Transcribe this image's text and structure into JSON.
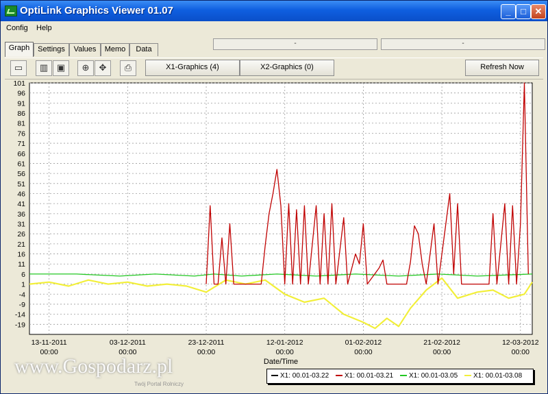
{
  "window": {
    "title": "OptiLink Graphics Viewer 01.07",
    "min_glyph": "_",
    "max_glyph": "□",
    "close_glyph": "✕"
  },
  "menu": [
    "Config",
    "Help"
  ],
  "tabs": [
    "Graph",
    "Settings",
    "Values",
    "Memo",
    "Data"
  ],
  "status_boxes": [
    "-",
    "-"
  ],
  "toolbar": {
    "x1_label": "X1-Graphics (4)",
    "x2_label": "X2-Graphics (0)",
    "refresh_label": "Refresh Now"
  },
  "icons": [
    "chart-view-icon",
    "columns-icon",
    "window-icon",
    "zoom-icon",
    "move-icon",
    "print-icon"
  ],
  "watermark": {
    "text": "www.Gospodarz.pl",
    "sub": "Twój Portal Rolniczy"
  },
  "colors": {
    "red_series": "#c00000",
    "green_series": "#22c722",
    "yellow_series": "#f2ef3a",
    "black_series": "#000000",
    "title_bar": "#0f5fe0"
  },
  "chart_data": {
    "type": "line",
    "xlabel": "Date/Time",
    "ylabel": "",
    "ylim": [
      -24,
      101
    ],
    "y_ticks": [
      101,
      96,
      91,
      86,
      81,
      76,
      71,
      66,
      61,
      56,
      51,
      46,
      41,
      36,
      31,
      26,
      21,
      16,
      11,
      6,
      1,
      -4,
      -9,
      -14,
      -19
    ],
    "x_range": [
      "2011-11-08",
      "2012-03-15"
    ],
    "x_ticks": [
      {
        "date": "2011-11-13",
        "label": "13-11-2011",
        "time": "00:00"
      },
      {
        "date": "2011-12-03",
        "label": "03-12-2011",
        "time": "00:00"
      },
      {
        "date": "2011-12-23",
        "label": "23-12-2011",
        "time": "00:00"
      },
      {
        "date": "2012-01-12",
        "label": "12-01-2012",
        "time": "00:00"
      },
      {
        "date": "2012-02-01",
        "label": "01-02-2012",
        "time": "00:00"
      },
      {
        "date": "2012-02-21",
        "label": "21-02-2012",
        "time": "00:00"
      },
      {
        "date": "2012-03-12",
        "label": "12-03-2012",
        "time": "00:00"
      }
    ],
    "grid": true,
    "legend_position": "bottom-right",
    "series": [
      {
        "name": "X1: 00.01-03.22",
        "color": "#000000",
        "points": []
      },
      {
        "name": "X1: 00.01-03.21",
        "color": "#c00000",
        "points": [
          [
            "2011-11-08",
            null
          ],
          [
            "2011-12-23",
            1
          ],
          [
            "2011-12-24",
            40
          ],
          [
            "2011-12-25",
            1
          ],
          [
            "2011-12-26",
            1
          ],
          [
            "2011-12-27",
            24
          ],
          [
            "2011-12-28",
            1
          ],
          [
            "2011-12-29",
            31
          ],
          [
            "2011-12-30",
            1
          ],
          [
            "2012-01-06",
            1
          ],
          [
            "2012-01-07",
            20
          ],
          [
            "2012-01-08",
            36
          ],
          [
            "2012-01-09",
            46
          ],
          [
            "2012-01-10",
            58
          ],
          [
            "2012-01-11",
            40
          ],
          [
            "2012-01-12",
            1
          ],
          [
            "2012-01-13",
            41
          ],
          [
            "2012-01-14",
            1
          ],
          [
            "2012-01-15",
            38
          ],
          [
            "2012-01-16",
            1
          ],
          [
            "2012-01-17",
            40
          ],
          [
            "2012-01-18",
            1
          ],
          [
            "2012-01-20",
            40
          ],
          [
            "2012-01-21",
            1
          ],
          [
            "2012-01-22",
            36
          ],
          [
            "2012-01-23",
            1
          ],
          [
            "2012-01-24",
            41
          ],
          [
            "2012-01-25",
            1
          ],
          [
            "2012-01-27",
            34
          ],
          [
            "2012-01-28",
            1
          ],
          [
            "2012-01-30",
            16
          ],
          [
            "2012-01-31",
            11
          ],
          [
            "2012-02-01",
            31
          ],
          [
            "2012-02-02",
            1
          ],
          [
            "2012-02-05",
            9
          ],
          [
            "2012-02-06",
            13
          ],
          [
            "2012-02-07",
            1
          ],
          [
            "2012-02-12",
            1
          ],
          [
            "2012-02-13",
            12
          ],
          [
            "2012-02-14",
            30
          ],
          [
            "2012-02-15",
            26
          ],
          [
            "2012-02-16",
            11
          ],
          [
            "2012-02-17",
            1
          ],
          [
            "2012-02-19",
            31
          ],
          [
            "2012-02-20",
            1
          ],
          [
            "2012-02-23",
            46
          ],
          [
            "2012-02-24",
            6
          ],
          [
            "2012-02-25",
            41
          ],
          [
            "2012-02-26",
            1
          ],
          [
            "2012-03-04",
            1
          ],
          [
            "2012-03-05",
            36
          ],
          [
            "2012-03-06",
            1
          ],
          [
            "2012-03-08",
            41
          ],
          [
            "2012-03-09",
            1
          ],
          [
            "2012-03-10",
            40
          ],
          [
            "2012-03-11",
            1
          ],
          [
            "2012-03-12",
            31
          ],
          [
            "2012-03-13",
            101
          ],
          [
            "2012-03-14",
            6
          ]
        ]
      },
      {
        "name": "X1: 00.01-03.05",
        "color": "#22c722",
        "points": [
          [
            "2011-11-08",
            6
          ],
          [
            "2011-11-20",
            6
          ],
          [
            "2011-12-01",
            5
          ],
          [
            "2011-12-10",
            6
          ],
          [
            "2011-12-20",
            5
          ],
          [
            "2011-12-25",
            6
          ],
          [
            "2012-01-01",
            5
          ],
          [
            "2012-01-10",
            6
          ],
          [
            "2012-01-20",
            5
          ],
          [
            "2012-01-30",
            6
          ],
          [
            "2012-02-10",
            5
          ],
          [
            "2012-02-20",
            6
          ],
          [
            "2012-03-01",
            5
          ],
          [
            "2012-03-15",
            6
          ]
        ]
      },
      {
        "name": "X1: 00.01-03.08",
        "color": "#f2ef3a",
        "points": [
          [
            "2011-11-08",
            1
          ],
          [
            "2011-11-13",
            2
          ],
          [
            "2011-11-18",
            0
          ],
          [
            "2011-11-23",
            3
          ],
          [
            "2011-11-28",
            1
          ],
          [
            "2011-12-03",
            2
          ],
          [
            "2011-12-08",
            0
          ],
          [
            "2011-12-13",
            1
          ],
          [
            "2011-12-18",
            0
          ],
          [
            "2011-12-23",
            -3
          ],
          [
            "2011-12-28",
            3
          ],
          [
            "2012-01-02",
            1
          ],
          [
            "2012-01-07",
            3
          ],
          [
            "2012-01-12",
            -4
          ],
          [
            "2012-01-17",
            -8
          ],
          [
            "2012-01-22",
            -6
          ],
          [
            "2012-01-27",
            -14
          ],
          [
            "2012-02-01",
            -18
          ],
          [
            "2012-02-04",
            -21
          ],
          [
            "2012-02-07",
            -16
          ],
          [
            "2012-02-10",
            -20
          ],
          [
            "2012-02-13",
            -11
          ],
          [
            "2012-02-17",
            -2
          ],
          [
            "2012-02-21",
            4
          ],
          [
            "2012-02-25",
            -6
          ],
          [
            "2012-03-01",
            -3
          ],
          [
            "2012-03-05",
            -2
          ],
          [
            "2012-03-09",
            -6
          ],
          [
            "2012-03-13",
            -4
          ],
          [
            "2012-03-15",
            2
          ]
        ]
      }
    ]
  }
}
